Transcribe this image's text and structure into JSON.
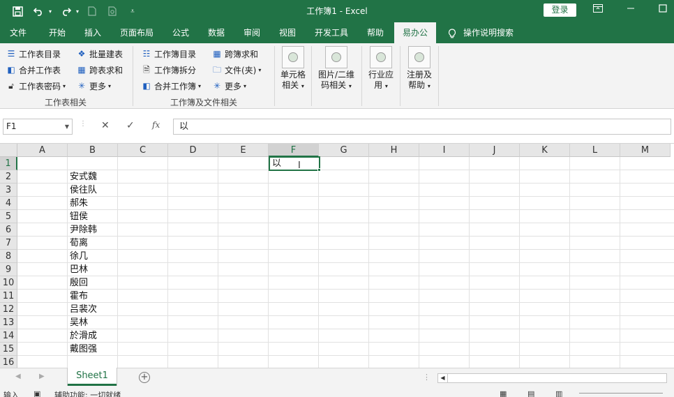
{
  "titlebar": {
    "title": "工作簿1  -  Excel",
    "login_label": "登录",
    "quick_access": [
      "save-icon",
      "undo-icon",
      "redo-icon",
      "new-file-icon",
      "print-preview-icon",
      "customize-icon"
    ]
  },
  "tabs": [
    {
      "label": "文件"
    },
    {
      "label": "开始"
    },
    {
      "label": "插入"
    },
    {
      "label": "页面布局"
    },
    {
      "label": "公式"
    },
    {
      "label": "数据"
    },
    {
      "label": "审阅"
    },
    {
      "label": "视图"
    },
    {
      "label": "开发工具"
    },
    {
      "label": "帮助"
    },
    {
      "label": "易办公",
      "active": true
    },
    {
      "label": "操作说明搜索"
    }
  ],
  "ribbon": {
    "group1": {
      "label": "工作表相关",
      "items": [
        "工作表目录",
        "合并工作表",
        "工作表密码",
        "批量建表",
        "跨表求和",
        "更多"
      ]
    },
    "group2": {
      "label": "工作簿及文件相关",
      "items": [
        "工作簿目录",
        "工作簿拆分",
        "合并工作簿",
        "跨簿求和",
        "文件(夹)",
        "更多"
      ]
    },
    "big_buttons": [
      {
        "line1": "单元格",
        "line2": "相关"
      },
      {
        "line1": "图片/二维",
        "line2": "码相关"
      },
      {
        "line1": "行业应",
        "line2": "用"
      },
      {
        "line1": "注册及",
        "line2": "帮助"
      }
    ]
  },
  "formula_bar": {
    "name_box": "F1",
    "formula": "以"
  },
  "grid": {
    "columns": [
      "A",
      "B",
      "C",
      "D",
      "E",
      "F",
      "G",
      "H",
      "I",
      "J",
      "K",
      "L",
      "M"
    ],
    "rows": [
      "1",
      "2",
      "3",
      "4",
      "5",
      "6",
      "7",
      "8",
      "9",
      "10",
      "11",
      "12",
      "13",
      "14",
      "15",
      "16"
    ],
    "selected_column": "F",
    "selected_row": "1",
    "active_cell_value": "以",
    "column_b_values": [
      "安式魏",
      "侯往队",
      "郝朱",
      "钮侯",
      "尹除韩",
      "荀离",
      "徐几",
      "巴林",
      "殷回",
      "霍布",
      "吕裴次",
      "吴林",
      "於滑成",
      "戴图强"
    ]
  },
  "sheets": [
    {
      "label": "Sheet1",
      "active": true
    }
  ],
  "statusbar": {
    "mode": "输入",
    "accessibility": "辅助功能: 一切就绪"
  }
}
